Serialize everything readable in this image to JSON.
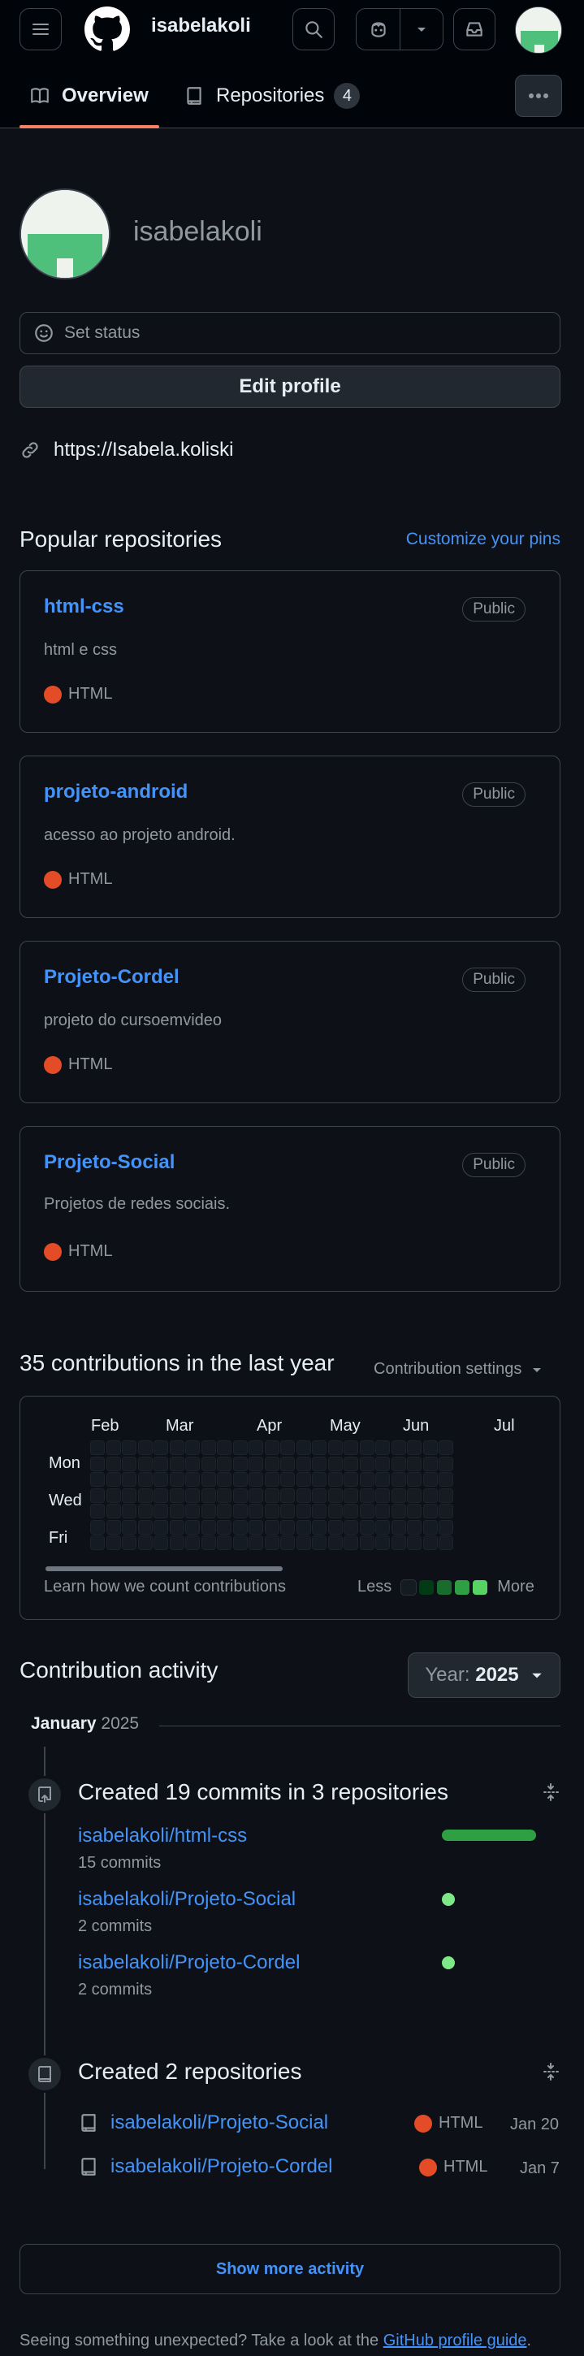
{
  "header": {
    "username": "isabelakoli",
    "tabs": [
      {
        "label": "Overview"
      },
      {
        "label": "Repositories",
        "count": "4"
      }
    ]
  },
  "profile": {
    "display_name": "isabelakoli",
    "status_label": "Set status",
    "edit_label": "Edit profile",
    "website": "https://Isabela.koliski"
  },
  "popular": {
    "title": "Popular repositories",
    "customize_label": "Customize your pins",
    "repos": [
      {
        "name": "html-css",
        "visibility": "Public",
        "description": "html e css",
        "language": "HTML"
      },
      {
        "name": "projeto-android",
        "visibility": "Public",
        "description": "acesso ao projeto android.",
        "language": "HTML"
      },
      {
        "name": "Projeto-Cordel",
        "visibility": "Public",
        "description": "projeto do cursoemvideo",
        "language": "HTML"
      },
      {
        "name": "Projeto-Social",
        "visibility": "Public",
        "description": "Projetos de redes sociais.",
        "language": "HTML"
      }
    ],
    "language_color": "#e34c26"
  },
  "contributions": {
    "title": "35 contributions in the last year",
    "settings_label": "Contribution settings",
    "months": [
      "Feb",
      "Mar",
      "Apr",
      "May",
      "Jun",
      "Jul"
    ],
    "days": [
      "Mon",
      "Wed",
      "Fri"
    ],
    "learn_label": "Learn how we count contributions",
    "legend_less": "Less",
    "legend_more": "More",
    "legend_colors": [
      "#151b23",
      "#033a16",
      "#196c2e",
      "#2ea043",
      "#56d364"
    ]
  },
  "activity": {
    "title": "Contribution activity",
    "year_prefix": "Year:",
    "year": "2025",
    "month_name": "January",
    "month_year": "2025",
    "commits_title": "Created 19 commits in 3 repositories",
    "commit_repos": [
      {
        "name": "isabelakoli/html-css",
        "count": "15 commits"
      },
      {
        "name": "isabelakoli/Projeto-Social",
        "count": "2 commits"
      },
      {
        "name": "isabelakoli/Projeto-Cordel",
        "count": "2 commits"
      }
    ],
    "created_title": "Created 2 repositories",
    "created_repos": [
      {
        "name": "isabelakoli/Projeto-Social",
        "language": "HTML",
        "date": "Jan 20"
      },
      {
        "name": "isabelakoli/Projeto-Cordel",
        "language": "HTML",
        "date": "Jan 7"
      }
    ],
    "show_more_label": "Show more activity"
  },
  "footer": {
    "note": "Seeing something unexpected? Take a look at the",
    "link": "GitHub profile guide",
    "end": "."
  }
}
